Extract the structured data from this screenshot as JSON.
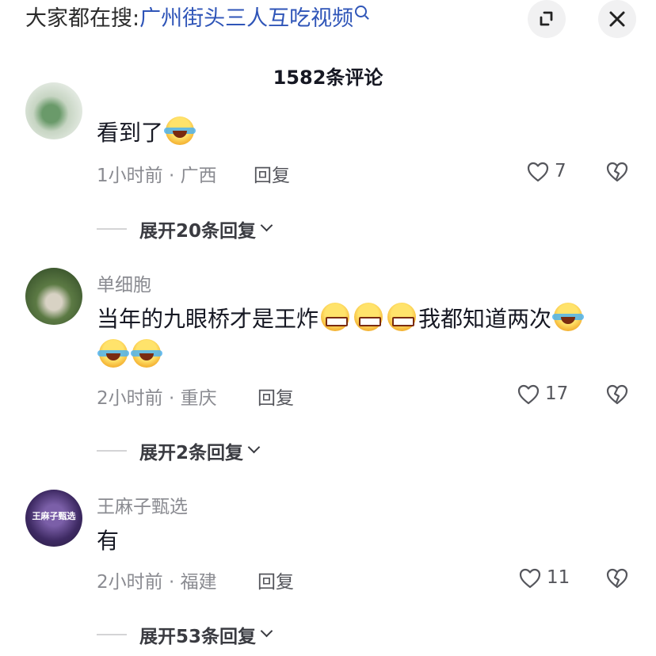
{
  "search": {
    "prefix": "大家都在搜:",
    "topic": "广州街头三人互吃视频"
  },
  "header": {
    "comment_count": "1582条评论"
  },
  "comments": [
    {
      "username": "",
      "text": "看到了",
      "emojis": [
        "laugh-cry"
      ],
      "time": "1小时前",
      "location": "广西",
      "reply_label": "回复",
      "likes": "7",
      "expand_label": "展开20条回复"
    },
    {
      "username": "单细胞",
      "text_a": "当年的九眼桥才是王炸",
      "text_b": "我都知道两次",
      "emojis": [
        "grin-sweat",
        "grin-sweat",
        "grin-sweat",
        "laugh-cry",
        "laugh-cry",
        "laugh-cry"
      ],
      "time": "2小时前",
      "location": "重庆",
      "reply_label": "回复",
      "likes": "17",
      "expand_label": "展开2条回复"
    },
    {
      "username": "王麻子甄选",
      "avatar_text": "王麻子甄选",
      "text": "有",
      "time": "2小时前",
      "location": "福建",
      "reply_label": "回复",
      "likes": "11",
      "expand_label": "展开53条回复"
    }
  ],
  "colors": {
    "topic_link": "#2f55b8",
    "secondary_text": "#8a8b91",
    "primary_text": "#161823"
  },
  "icons": [
    "search-hint-icon",
    "expand-icon",
    "close-icon",
    "heart-icon",
    "broken-heart-icon",
    "chevron-down-icon"
  ]
}
